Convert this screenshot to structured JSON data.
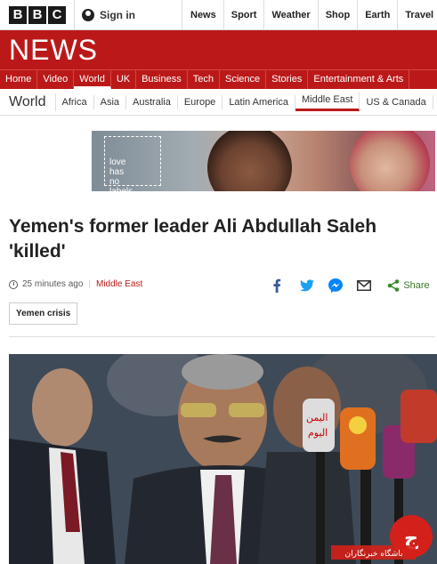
{
  "bbc_logo": [
    "B",
    "B",
    "C"
  ],
  "signin": {
    "label": "Sign in",
    "icon": "user-icon"
  },
  "top_nav": [
    "News",
    "Sport",
    "Weather",
    "Shop",
    "Earth",
    "Travel"
  ],
  "masthead": {
    "title": "NEWS"
  },
  "section_nav": {
    "items": [
      "Home",
      "Video",
      "World",
      "UK",
      "Business",
      "Tech",
      "Science",
      "Stories",
      "Entertainment & Arts"
    ],
    "active": "World"
  },
  "sub_nav": {
    "section": "World",
    "items": [
      "Africa",
      "Asia",
      "Australia",
      "Europe",
      "Latin America",
      "Middle East",
      "US & Canada"
    ],
    "active": "Middle East"
  },
  "ad": {
    "text_lines": [
      "love",
      "has",
      "no",
      "labels"
    ]
  },
  "article": {
    "headline": "Yemen's former leader Ali Abdullah Saleh 'killed'",
    "timestamp": "25 minutes ago",
    "section_link": "Middle East",
    "tag": "Yemen crisis"
  },
  "share": {
    "label": "Share",
    "icons": [
      "facebook-icon",
      "twitter-icon",
      "messenger-icon",
      "email-icon",
      "share-icon"
    ]
  },
  "photo": {
    "mic_labels": [
      "اليمن",
      "اليوم"
    ],
    "watermark": "باشگاه خبرنگاران"
  },
  "colors": {
    "brand_red": "#bb1919",
    "text_dark": "#222222"
  }
}
